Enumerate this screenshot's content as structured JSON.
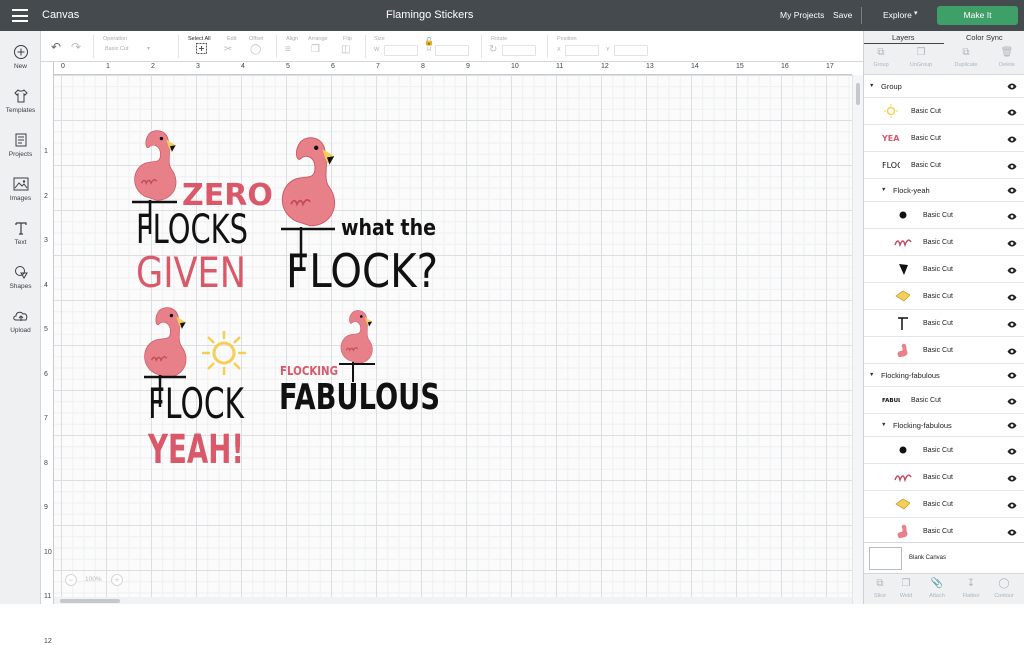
{
  "topbar": {
    "app_name": "Canvas",
    "project_title": "Flamingo Stickers",
    "my_projects": "My Projects",
    "save": "Save",
    "explore": "Explore",
    "make_it": "Make It"
  },
  "leftbar": {
    "items": [
      {
        "label": "New",
        "icon": "plus-circle-icon"
      },
      {
        "label": "Templates",
        "icon": "tshirt-icon"
      },
      {
        "label": "Projects",
        "icon": "projects-icon"
      },
      {
        "label": "Images",
        "icon": "image-icon"
      },
      {
        "label": "Text",
        "icon": "text-icon"
      },
      {
        "label": "Shapes",
        "icon": "shapes-icon"
      },
      {
        "label": "Upload",
        "icon": "cloud-upload-icon"
      }
    ]
  },
  "toolbar": {
    "operation_label": "Operation",
    "operation_value": "Basic Cut",
    "select_all": "Select All",
    "edit": "Edit",
    "offset": "Offset",
    "align": "Align",
    "arrange": "Arrange",
    "flip": "Flip",
    "size": "Size",
    "w": "W",
    "h": "H",
    "rotate": "Rotate",
    "position": "Position",
    "x": "X",
    "y": "Y"
  },
  "ruler": {
    "top": [
      "0",
      "1",
      "2",
      "3",
      "4",
      "5",
      "6",
      "7",
      "8",
      "9",
      "10",
      "11",
      "12",
      "13",
      "14",
      "15",
      "16",
      "17"
    ],
    "left": [
      "1",
      "2",
      "3",
      "4",
      "5",
      "6",
      "7",
      "8",
      "9",
      "10",
      "11",
      "12"
    ]
  },
  "zoom": {
    "value": "100%"
  },
  "designs": {
    "zero_flocks": {
      "line1": "ZERO",
      "line2": "FLOCKS",
      "line3": "GIVEN"
    },
    "what_the_flock": {
      "line1": "what the",
      "line2": "FLOCK?"
    },
    "flock_yeah": {
      "line1": "FLOCK",
      "line2": "YEAH!"
    },
    "flocking_fabulous": {
      "line1": "FLOCKING",
      "line2": "FABULOUS"
    }
  },
  "right_panel": {
    "tabs": [
      "Layers",
      "Color Sync"
    ],
    "tools": [
      "Group",
      "UnGroup",
      "Duplicate",
      "Delete"
    ],
    "layers": [
      {
        "type": "group",
        "name": "Group",
        "indent": 0
      },
      {
        "type": "item",
        "name": "Basic Cut",
        "thumb": "sun",
        "indent": 0
      },
      {
        "type": "item",
        "name": "Basic Cut",
        "thumb": "yeah-text",
        "indent": 0
      },
      {
        "type": "item",
        "name": "Basic Cut",
        "thumb": "flock-text",
        "indent": 0
      },
      {
        "type": "group",
        "name": "Flock-yeah",
        "indent": 1
      },
      {
        "type": "item",
        "name": "Basic Cut",
        "thumb": "dot",
        "indent": 1
      },
      {
        "type": "item",
        "name": "Basic Cut",
        "thumb": "squiggle",
        "indent": 1
      },
      {
        "type": "item",
        "name": "Basic Cut",
        "thumb": "beak",
        "indent": 1
      },
      {
        "type": "item",
        "name": "Basic Cut",
        "thumb": "yellow-beak",
        "indent": 1
      },
      {
        "type": "item",
        "name": "Basic Cut",
        "thumb": "legs",
        "indent": 1
      },
      {
        "type": "item",
        "name": "Basic Cut",
        "thumb": "flamingo",
        "indent": 1
      },
      {
        "type": "group",
        "name": "Flocking-fabulous",
        "indent": 0
      },
      {
        "type": "item",
        "name": "Basic Cut",
        "thumb": "fabulous-text",
        "indent": 0
      },
      {
        "type": "group",
        "name": "Flocking-fabulous",
        "indent": 1
      },
      {
        "type": "item",
        "name": "Basic Cut",
        "thumb": "dot",
        "indent": 1
      },
      {
        "type": "item",
        "name": "Basic Cut",
        "thumb": "squiggle",
        "indent": 1
      },
      {
        "type": "item",
        "name": "Basic Cut",
        "thumb": "yellow-beak",
        "indent": 1
      },
      {
        "type": "item",
        "name": "Basic Cut",
        "thumb": "flamingo",
        "indent": 1
      }
    ],
    "blank_canvas": "Blank Canvas",
    "bottom_tools": [
      "Slice",
      "Weld",
      "Attach",
      "Flatten",
      "Contour"
    ]
  },
  "colors": {
    "topbar": "#454a4f",
    "make_it": "#3f9f69",
    "flamingo_pink": "#e8808a",
    "sun_yellow": "#f5cf55",
    "text_pink": "#d9596b"
  }
}
